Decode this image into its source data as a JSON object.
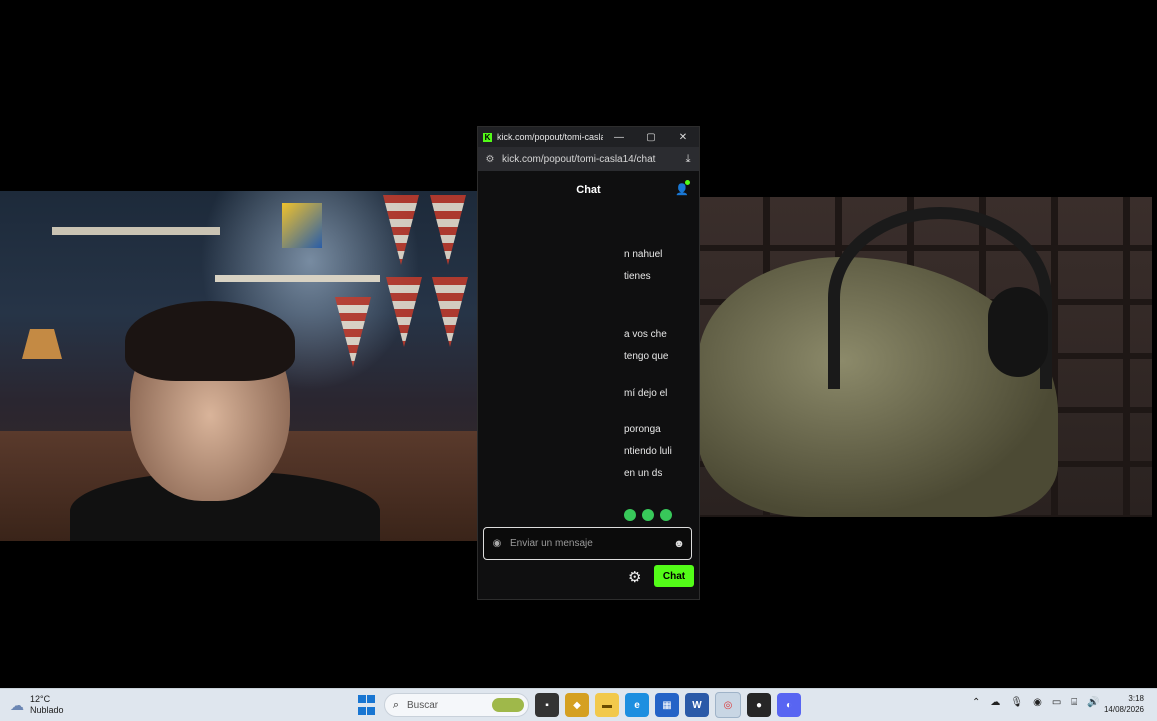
{
  "popout": {
    "tab_title": "kick.com/popout/tomi-casla...",
    "url": "kick.com/popout/tomi-casla14/chat",
    "chat_title": "Chat",
    "messages": [
      "n nahuel",
      "tienes",
      "a vos che",
      "tengo que",
      "mí dejo el",
      "poronga",
      "ntiendo luli",
      "en un ds"
    ],
    "input_placeholder": "Enviar un mensaje",
    "send_label": "Chat",
    "accent": "#53fc18"
  },
  "taskbar": {
    "weather_temp": "12°C",
    "weather_desc": "Nublado",
    "search_label": "Buscar",
    "time": "3:18",
    "date": "14/08/2026",
    "apps": [
      "file-explorer-icon",
      "edge-icon",
      "store-icon",
      "word-icon",
      "chrome-icon",
      "obs-icon",
      "discord-icon"
    ]
  }
}
